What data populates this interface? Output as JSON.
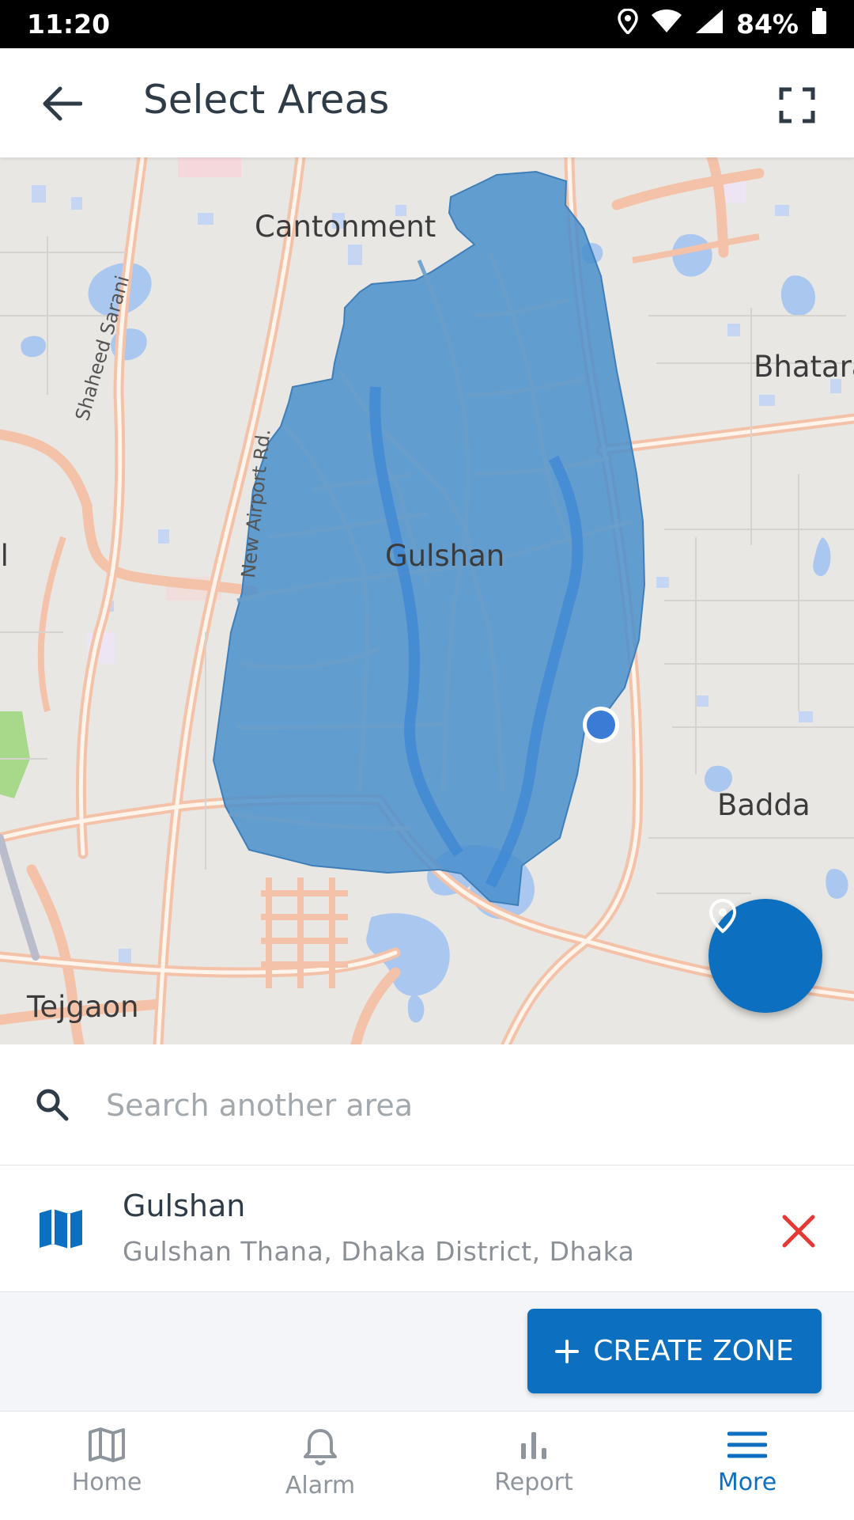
{
  "status_bar": {
    "time": "11:20",
    "battery": "84%"
  },
  "header": {
    "title": "Select Areas"
  },
  "map": {
    "place_labels": [
      "Cantonment",
      "Bhatara",
      "Gulshan",
      "Badda",
      "Tejgaon",
      "al"
    ],
    "road_labels": [
      "Shaheed Sarani",
      "New Airport Rd."
    ],
    "selected_area_color": "#4a90c9",
    "current_location_color": "#3a7bd5"
  },
  "search": {
    "placeholder": "Search another area"
  },
  "selected_area": {
    "name": "Gulshan",
    "subtitle": "Gulshan Thana, Dhaka District, Dhaka",
    "icon": "map-icon",
    "remove_icon": "close-icon",
    "remove_color": "#e53935"
  },
  "actions": {
    "create_zone_label": "CREATE ZONE"
  },
  "bottom_nav": {
    "items": [
      {
        "label": "Home",
        "icon": "map-icon"
      },
      {
        "label": "Alarm",
        "icon": "bell-icon"
      },
      {
        "label": "Report",
        "icon": "bar-chart-icon"
      },
      {
        "label": "More",
        "icon": "menu-icon"
      }
    ],
    "active": "More"
  },
  "colors": {
    "primary": "#0d6fbf",
    "text_dark": "#2f3b46",
    "text_muted": "#8a9096"
  }
}
